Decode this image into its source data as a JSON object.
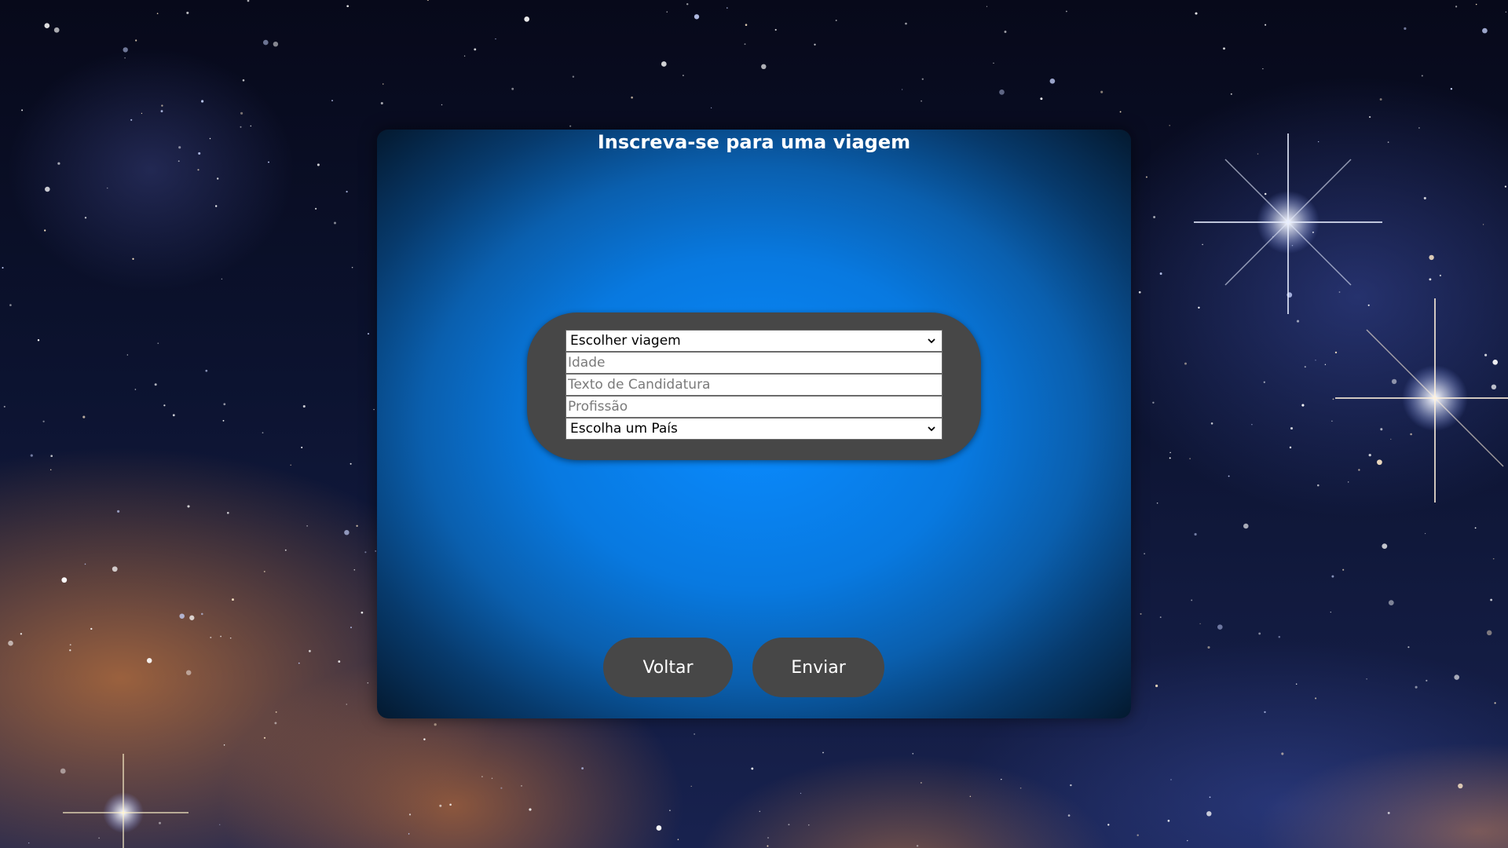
{
  "colors": {
    "modal_center": "#0a8bff",
    "modal_edge": "#04192f",
    "panel": "#474747",
    "button": "#474747",
    "field_bg": "#ffffff",
    "placeholder": "#7a7a7a"
  },
  "modal": {
    "title": "Inscreva-se para uma viagem"
  },
  "form": {
    "trip_select": {
      "value": "Escolher viagem",
      "icon": "chevron-down-icon"
    },
    "age_input": {
      "placeholder": "Idade",
      "value": ""
    },
    "application_text_input": {
      "placeholder": "Texto de Candidatura",
      "value": ""
    },
    "profession_input": {
      "placeholder": "Profissão",
      "value": ""
    },
    "country_select": {
      "value": "Escolha um País",
      "icon": "chevron-down-icon"
    }
  },
  "actions": {
    "back_label": "Voltar",
    "submit_label": "Enviar"
  }
}
